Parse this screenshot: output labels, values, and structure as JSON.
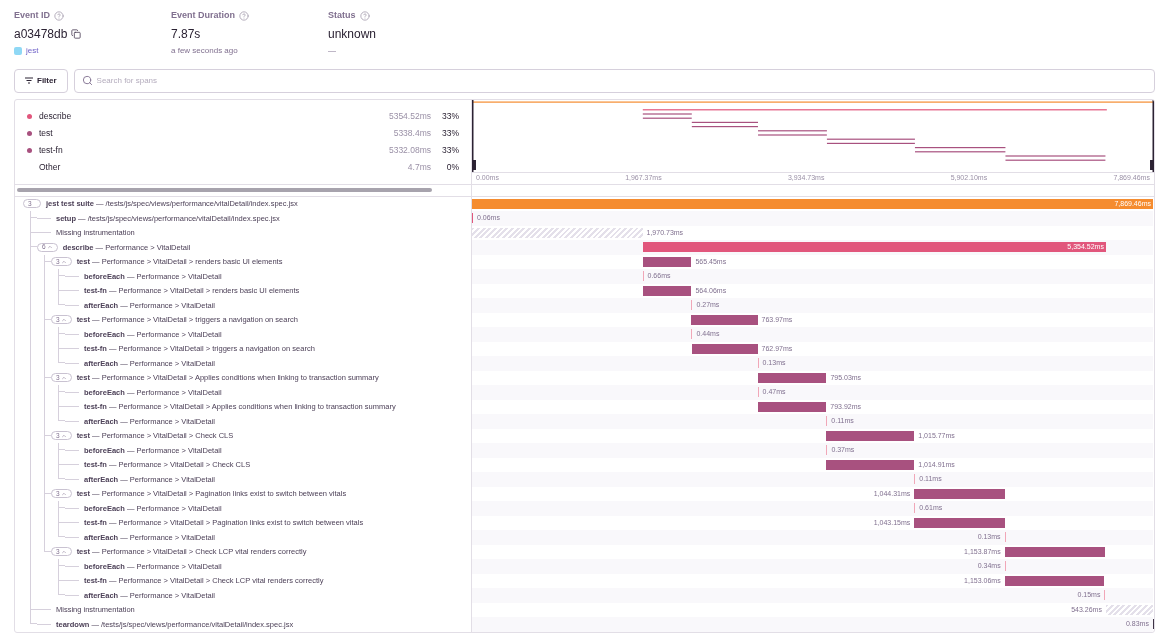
{
  "header": {
    "fields": [
      {
        "label": "Event ID",
        "value": "a03478db",
        "kind": "id",
        "sub": "jest"
      },
      {
        "label": "Event Duration",
        "value": "7.87s",
        "kind": "plain",
        "sub": "a few seconds ago"
      },
      {
        "label": "Status",
        "value": "unknown",
        "kind": "plain",
        "sub": "—"
      }
    ]
  },
  "filter": {
    "button": "Filter",
    "search": {
      "placeholder": "Search for spans"
    }
  },
  "legend": [
    {
      "name": "describe",
      "duration": "5354.52ms",
      "percent": "33%",
      "color": "#e1567c"
    },
    {
      "name": "test",
      "duration": "5338.4ms",
      "percent": "33%",
      "color": "#a8517f"
    },
    {
      "name": "test-fn",
      "duration": "5332.08ms",
      "percent": "33%",
      "color": "#a8517f"
    },
    {
      "name": "Other",
      "duration": "4.7ms",
      "percent": "0%"
    }
  ],
  "axis_ticks": [
    "0.00ms",
    "1,967.37ms",
    "3,934.73ms",
    "5,902.10ms",
    "7,869.46ms"
  ],
  "spans": [
    {
      "kind": "span",
      "label": "**jest test suite** — /tests/js/spec/views/performance/vitalDetail/index.spec.jsx",
      "count": "3",
      "duration": "7,869.46ms",
      "color": "#f58c2f",
      "children": [
        {
          "kind": "span",
          "label": "**setup** — /tests/js/spec/views/performance/vitalDetail/index.spec.jsx",
          "duration": "0.06ms",
          "color": "#e1567c"
        },
        {
          "kind": "gap",
          "label": "Missing instrumentation",
          "duration": "1,970.73ms"
        },
        {
          "kind": "span",
          "label": "**describe** — Performance > VitalDetail",
          "count": "6",
          "expanded": true,
          "duration": "5,354.52ms",
          "color": "#e1567c",
          "children": [
            {
              "kind": "span",
              "label": "**test** — Performance > VitalDetail > renders basic UI elements",
              "count": "3",
              "expanded": true,
              "duration": "565.45ms",
              "color": "#a8517f",
              "children": [
                {
                  "kind": "span",
                  "label": "**beforeEach** — Performance > VitalDetail",
                  "duration": "0.66ms",
                  "color": "#f1a7b8"
                },
                {
                  "kind": "span",
                  "label": "**test-fn** — Performance > VitalDetail > renders basic UI elements",
                  "duration": "564.06ms",
                  "color": "#a8517f"
                },
                {
                  "kind": "span",
                  "label": "**afterEach** — Performance > VitalDetail",
                  "duration": "0.27ms",
                  "color": "#f1a7b8"
                }
              ]
            },
            {
              "kind": "span",
              "label": "**test** — Performance > VitalDetail > triggers a navigation on search",
              "count": "3",
              "expanded": true,
              "duration": "763.97ms",
              "color": "#a8517f",
              "children": [
                {
                  "kind": "span",
                  "label": "**beforeEach** — Performance > VitalDetail",
                  "duration": "0.44ms",
                  "color": "#f1a7b8"
                },
                {
                  "kind": "span",
                  "label": "**test-fn** — Performance > VitalDetail > triggers a navigation on search",
                  "duration": "762.97ms",
                  "color": "#a8517f"
                },
                {
                  "kind": "span",
                  "label": "**afterEach** — Performance > VitalDetail",
                  "duration": "0.13ms",
                  "color": "#f1a7b8"
                }
              ]
            },
            {
              "kind": "span",
              "label": "**test** — Performance > VitalDetail > Applies conditions when linking to transaction summary",
              "count": "3",
              "expanded": true,
              "duration": "795.03ms",
              "color": "#a8517f",
              "children": [
                {
                  "kind": "span",
                  "label": "**beforeEach** — Performance > VitalDetail",
                  "duration": "0.47ms",
                  "color": "#f1a7b8"
                },
                {
                  "kind": "span",
                  "label": "**test-fn** — Performance > VitalDetail > Applies conditions when linking to transaction summary",
                  "duration": "793.92ms",
                  "color": "#a8517f"
                },
                {
                  "kind": "span",
                  "label": "**afterEach** — Performance > VitalDetail",
                  "duration": "0.11ms",
                  "color": "#f1a7b8"
                }
              ]
            },
            {
              "kind": "span",
              "label": "**test** — Performance > VitalDetail > Check CLS",
              "count": "3",
              "expanded": true,
              "duration": "1,015.77ms",
              "color": "#a8517f",
              "children": [
                {
                  "kind": "span",
                  "label": "**beforeEach** — Performance > VitalDetail",
                  "duration": "0.37ms",
                  "color": "#f1a7b8"
                },
                {
                  "kind": "span",
                  "label": "**test-fn** — Performance > VitalDetail > Check CLS",
                  "duration": "1,014.91ms",
                  "color": "#a8517f"
                },
                {
                  "kind": "span",
                  "label": "**afterEach** — Performance > VitalDetail",
                  "duration": "0.11ms",
                  "color": "#f1a7b8"
                }
              ]
            },
            {
              "kind": "span",
              "label": "**test** — Performance > VitalDetail > Pagination links exist to switch between vitals",
              "count": "3",
              "expanded": true,
              "duration": "1,044.31ms",
              "color": "#a8517f",
              "children": [
                {
                  "kind": "span",
                  "label": "**beforeEach** — Performance > VitalDetail",
                  "duration": "0.61ms",
                  "color": "#f1a7b8"
                },
                {
                  "kind": "span",
                  "label": "**test-fn** — Performance > VitalDetail > Pagination links exist to switch between vitals",
                  "duration": "1,043.15ms",
                  "color": "#a8517f"
                },
                {
                  "kind": "span",
                  "label": "**afterEach** — Performance > VitalDetail",
                  "duration": "0.13ms",
                  "color": "#f1a7b8"
                }
              ]
            },
            {
              "kind": "span",
              "label": "**test** — Performance > VitalDetail > Check LCP vital renders correctly",
              "count": "3",
              "expanded": true,
              "duration": "1,153.87ms",
              "color": "#a8517f",
              "children": [
                {
                  "kind": "span",
                  "label": "**beforeEach** — Performance > VitalDetail",
                  "duration": "0.34ms",
                  "color": "#f1a7b8"
                },
                {
                  "kind": "span",
                  "label": "**test-fn** — Performance > VitalDetail > Check LCP vital renders correctly",
                  "duration": "1,153.06ms",
                  "color": "#a8517f"
                },
                {
                  "kind": "span",
                  "label": "**afterEach** — Performance > VitalDetail",
                  "duration": "0.15ms",
                  "color": "#f1a7b8"
                }
              ]
            }
          ]
        },
        {
          "kind": "gap",
          "label": "Missing instrumentation",
          "duration": "543.26ms"
        },
        {
          "kind": "span",
          "label": "**teardown** — /tests/js/spec/views/performance/vitalDetail/index.spec.jsx",
          "duration": "0.83ms",
          "color": "#3e3446"
        }
      ]
    }
  ]
}
